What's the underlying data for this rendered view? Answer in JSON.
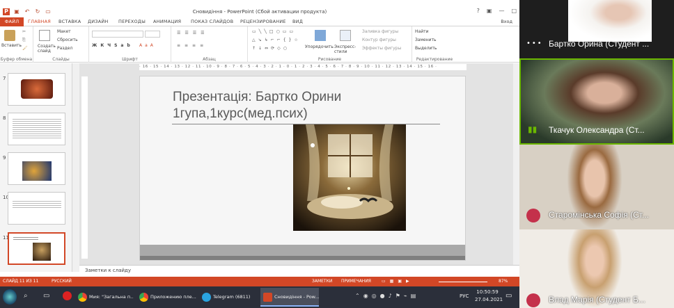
{
  "window": {
    "title": "Сновидіння - PowerPoint (Сбой активации продукта)",
    "help": "?",
    "signin": "Вход"
  },
  "tabs": [
    "ФАЙЛ",
    "ГЛАВНАЯ",
    "ВСТАВКА",
    "ДИЗАЙН",
    "ПЕРЕХОДЫ",
    "АНИМАЦИЯ",
    "ПОКАЗ СЛАЙДОВ",
    "РЕЦЕНЗИРОВАНИЕ",
    "ВИД"
  ],
  "ribbon": {
    "paste": "Вставить",
    "clipboard": "Буфер обмена",
    "cut": "Макет",
    "reset": "Сбросить",
    "section": "Раздел",
    "new_slide": "Создать слайд",
    "slides": "Слайды",
    "font": "Шрифт",
    "paragraph": "Абзац",
    "arrange": "Упорядочить",
    "styles": "Экспресс-стили",
    "fill": "Заливка фигуры",
    "outline": "Контур фигуры",
    "effects": "Эффекты фигуры",
    "drawing": "Рисование",
    "find": "Найти",
    "replace": "Заменить",
    "select": "Выделить",
    "editing": "Редактирование"
  },
  "thumbnails": [
    {
      "num": "7"
    },
    {
      "num": "8"
    },
    {
      "num": "9"
    },
    {
      "num": "10"
    },
    {
      "num": "11"
    }
  ],
  "ruler": "· 16 · 15 · 14 · 13 · 12 · 11 · 10 · 9 · 8 · 7 · 6 · 5 · 4 · 3 · 2 · 1 · 0 · 1 · 2 · 3 · 4 · 5 · 6 · 7 · 8 · 9 · 10 · 11 · 12 · 13 · 14 · 15 · 16 ·",
  "slide": {
    "title": "Презентація: Бартко Орини\n1гупа,1курс(мед.псих)"
  },
  "notes": "Заметки к слайду",
  "status": {
    "slide": "СЛАЙД 11 ИЗ 11",
    "lang": "РУССКИЙ",
    "notes": "ЗАМЕТКИ",
    "comments": "ПРИМЕЧАНИЯ",
    "zoom": "87%"
  },
  "taskbar": {
    "items": [
      "Мия: \"Загальна п...",
      "Приложению пле...",
      "Telegram (6811)",
      "Сновидіння - Pow..."
    ],
    "time": "10:50:59",
    "date": "27.04.2021",
    "lang": "РУС"
  },
  "participants": [
    {
      "name": "Бартко Орина (Студент ...",
      "status": "dots"
    },
    {
      "name": "Ткачук Олександра (Ст...",
      "status": "speaking"
    },
    {
      "name": "Старомінська Софія (Ст...",
      "status": "muted"
    },
    {
      "name": "Влад Марія (Студент Б...",
      "status": "muted"
    }
  ],
  "colors": {
    "accent": "#d24726",
    "muted": "#c4314b",
    "speaking": "#6bb700"
  }
}
